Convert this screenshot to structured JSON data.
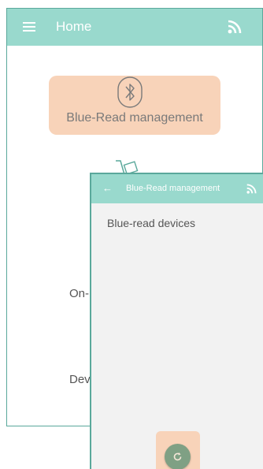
{
  "home": {
    "title": "Home",
    "menu_icon": "hamburger-menu-icon",
    "rss_icon": "rss-feed-icon",
    "cards": [
      {
        "label": "Blue-Read management",
        "icon": "bluetooth-icon"
      }
    ],
    "secondary_icon": "hand-truck-icon",
    "peek_items": [
      "On-",
      "Dev"
    ]
  },
  "blue_read": {
    "title": "Blue-Read management",
    "back_icon": "←",
    "rss_icon": "rss-feed-icon",
    "heading": "Blue-read devices",
    "refresh_icon": "refresh-icon"
  },
  "colors": {
    "appbar": "#99d9cd",
    "card": "#f8d3b9",
    "fab": "#7fa084",
    "border": "#5aa89b"
  }
}
